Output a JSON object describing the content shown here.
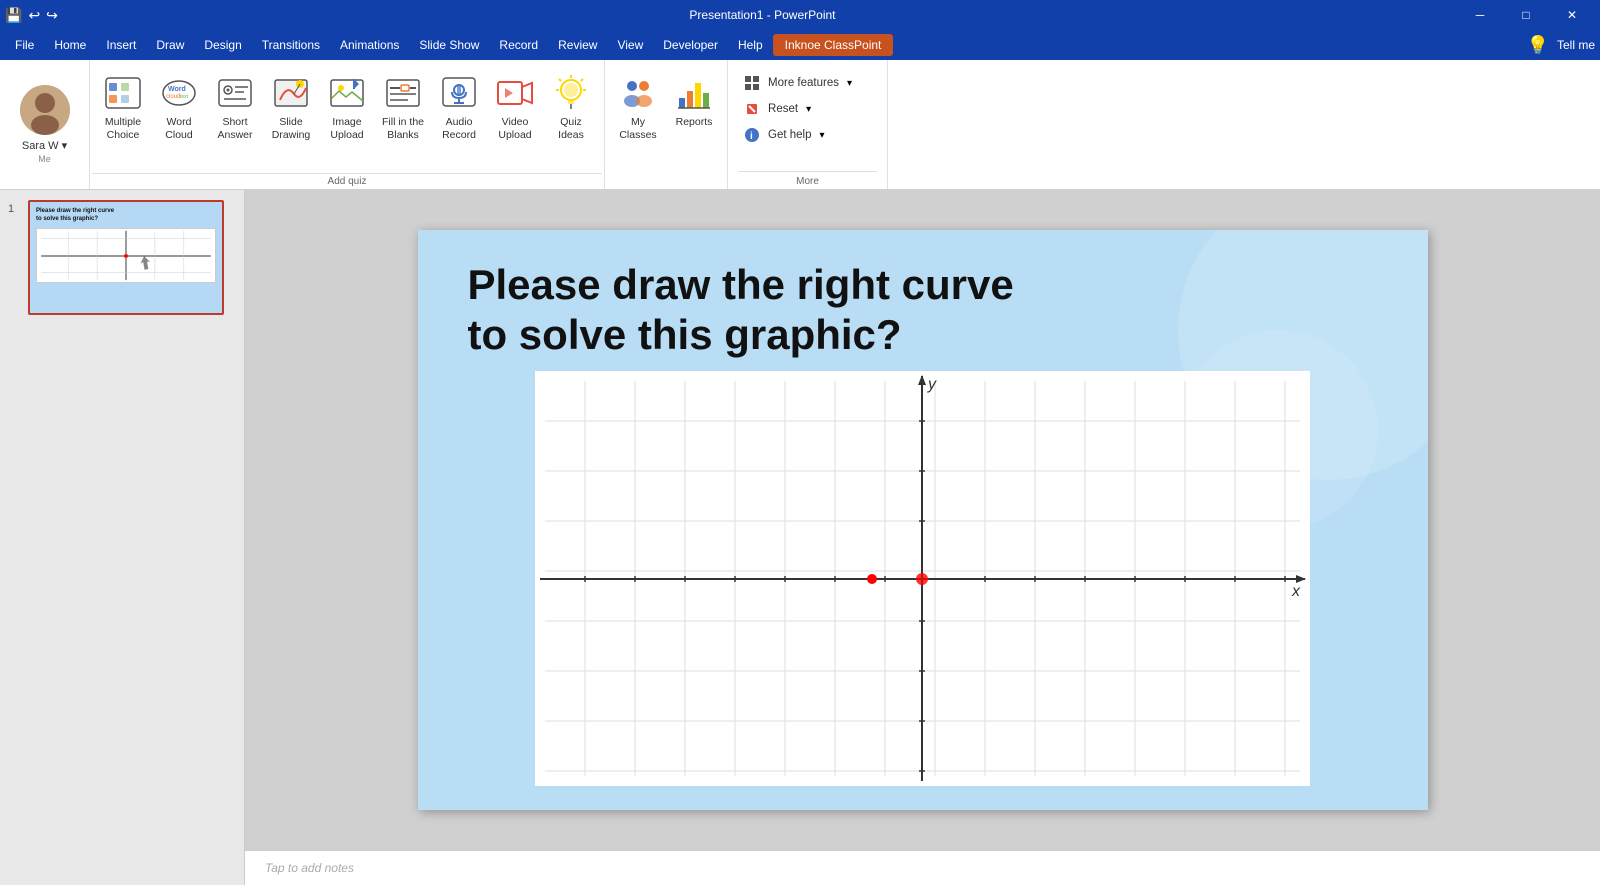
{
  "titlebar": {
    "title": "Presentation1 - PowerPoint"
  },
  "menubar": {
    "items": [
      {
        "label": "File",
        "active": false
      },
      {
        "label": "Home",
        "active": false
      },
      {
        "label": "Insert",
        "active": false
      },
      {
        "label": "Draw",
        "active": false
      },
      {
        "label": "Design",
        "active": false
      },
      {
        "label": "Transitions",
        "active": false
      },
      {
        "label": "Animations",
        "active": false
      },
      {
        "label": "Slide Show",
        "active": false
      },
      {
        "label": "Record",
        "active": false
      },
      {
        "label": "Review",
        "active": false
      },
      {
        "label": "View",
        "active": false
      },
      {
        "label": "Developer",
        "active": false
      },
      {
        "label": "Help",
        "active": false
      },
      {
        "label": "Inknoe ClassPoint",
        "active": true
      }
    ],
    "tell_me": "Tell me"
  },
  "ribbon": {
    "user": {
      "name": "Sara W",
      "name_label": "Sara W ▾"
    },
    "add_quiz_group": {
      "label": "Add quiz",
      "buttons": [
        {
          "id": "multiple-choice",
          "label": "Multiple\nChoice",
          "icon": "mc"
        },
        {
          "id": "word-cloud",
          "label": "Word\nCloud",
          "icon": "wc"
        },
        {
          "id": "short-answer",
          "label": "Short\nAnswer",
          "icon": "sa"
        },
        {
          "id": "slide-drawing",
          "label": "Slide\nDrawing",
          "icon": "sd"
        },
        {
          "id": "image-upload",
          "label": "Image\nUpload",
          "icon": "iu"
        },
        {
          "id": "fill-blanks",
          "label": "Fill in the\nBlanks",
          "icon": "fb"
        },
        {
          "id": "audio-record",
          "label": "Audio\nRecord",
          "icon": "ar"
        },
        {
          "id": "video-upload",
          "label": "Video\nUpload",
          "icon": "vu"
        },
        {
          "id": "quiz-ideas",
          "label": "Quiz\nIdeas",
          "icon": "qi"
        }
      ]
    },
    "more_group": {
      "label": "More",
      "buttons": [
        {
          "id": "my-classes",
          "label": "My\nClasses",
          "icon": "classes"
        },
        {
          "id": "reports",
          "label": "Reports",
          "icon": "reports"
        }
      ],
      "actions": [
        {
          "id": "more-features",
          "label": "More features",
          "icon": "grid"
        },
        {
          "id": "reset",
          "label": "Reset",
          "icon": "reset"
        },
        {
          "id": "get-help",
          "label": "Get help",
          "icon": "help"
        }
      ]
    }
  },
  "slides": [
    {
      "number": "1",
      "title": "Please draw the right curve\nto solve this graphic?",
      "selected": true
    }
  ],
  "main_slide": {
    "title_line1": "Please draw the right curve",
    "title_line2": "to solve this graphic?",
    "graph_y_label": "y",
    "graph_x_label": "x"
  },
  "notes": {
    "placeholder": "Tap to add notes"
  }
}
